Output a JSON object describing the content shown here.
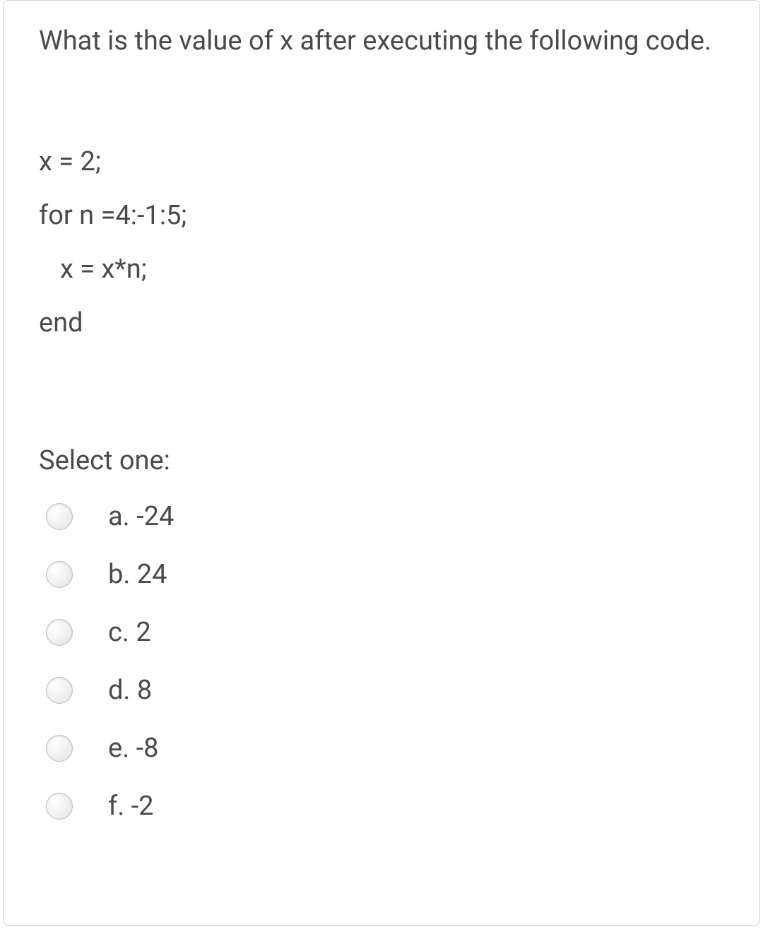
{
  "question": {
    "text": "What is the value of x after executing the following code.",
    "code": {
      "line1": "x = 2;",
      "line2": "for n =4:-1:5;",
      "line3": "x = x*n;",
      "line4": "end"
    },
    "selectPrompt": "Select one:",
    "options": [
      {
        "label": "a. -24"
      },
      {
        "label": "b. 24"
      },
      {
        "label": "c. 2"
      },
      {
        "label": "d. 8"
      },
      {
        "label": "e. -8"
      },
      {
        "label": "f. -2"
      }
    ]
  }
}
